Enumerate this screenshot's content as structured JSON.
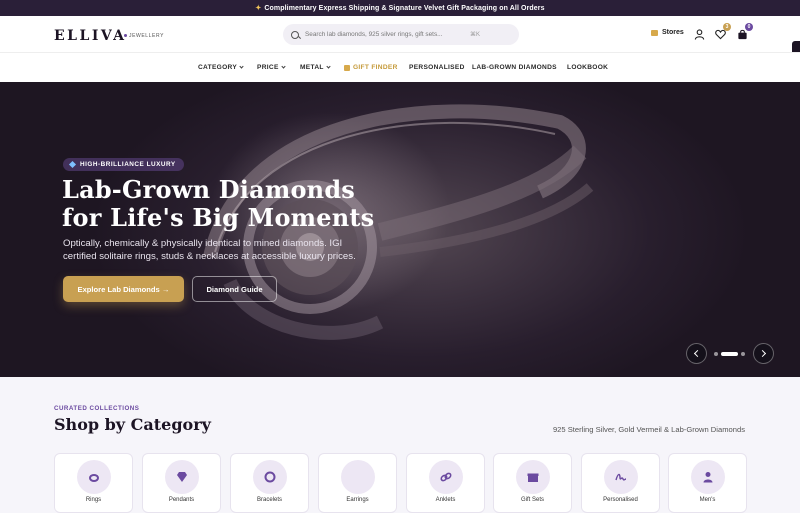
{
  "announcement": {
    "icon": "sparkle-icon",
    "text": "Complimentary Express Shipping & Signature Velvet Gift Packaging on All Orders"
  },
  "brand": {
    "name": "ELLIVA",
    "sub": "JEWELLERY"
  },
  "search": {
    "placeholder": "Search lab diamonds, 925 silver rings, gift sets...",
    "camera_glyph": "⌘K"
  },
  "header": {
    "stores_label": "Stores",
    "wishlist_count": "3",
    "cart_count": "0"
  },
  "nav": {
    "items": [
      "CATEGORY",
      "PRICE",
      "METAL",
      "GIFT FINDER",
      "PERSONALISED",
      "LAB-GROWN DIAMONDS",
      "LOOKBOOK"
    ]
  },
  "hero": {
    "pill": "HIGH-BRILLIANCE LUXURY",
    "title_line1": "Lab-Grown Diamonds",
    "title_line2": "for Life's Big Moments",
    "subtitle": "Optically, chemically & physically identical to mined diamonds. IGI certified solitaire rings, studs & necklaces at accessible luxury prices.",
    "primary_cta": "Explore Lab Diamonds →",
    "secondary_cta": "Diamond Guide",
    "slides_total": 3,
    "active_slide": 2
  },
  "categories": {
    "kicker": "CURATED COLLECTIONS",
    "title": "Shop by Category",
    "right_text": "925 Sterling Silver, Gold Vermeil & Lab-Grown Diamonds",
    "items": [
      {
        "label": "Rings",
        "icon": "ring-icon"
      },
      {
        "label": "Pendants",
        "icon": "gem-icon"
      },
      {
        "label": "Bracelets",
        "icon": "bracelet-icon"
      },
      {
        "label": "Earrings",
        "icon": "earring-icon"
      },
      {
        "label": "Anklets",
        "icon": "link-icon"
      },
      {
        "label": "Gift Sets",
        "icon": "gift-box-icon"
      },
      {
        "label": "Personalised",
        "icon": "signature-icon"
      },
      {
        "label": "Men's",
        "icon": "person-icon"
      }
    ]
  },
  "colors": {
    "accent": "#6b4aa0",
    "gold": "#c8a052",
    "dark": "#1c1424"
  }
}
